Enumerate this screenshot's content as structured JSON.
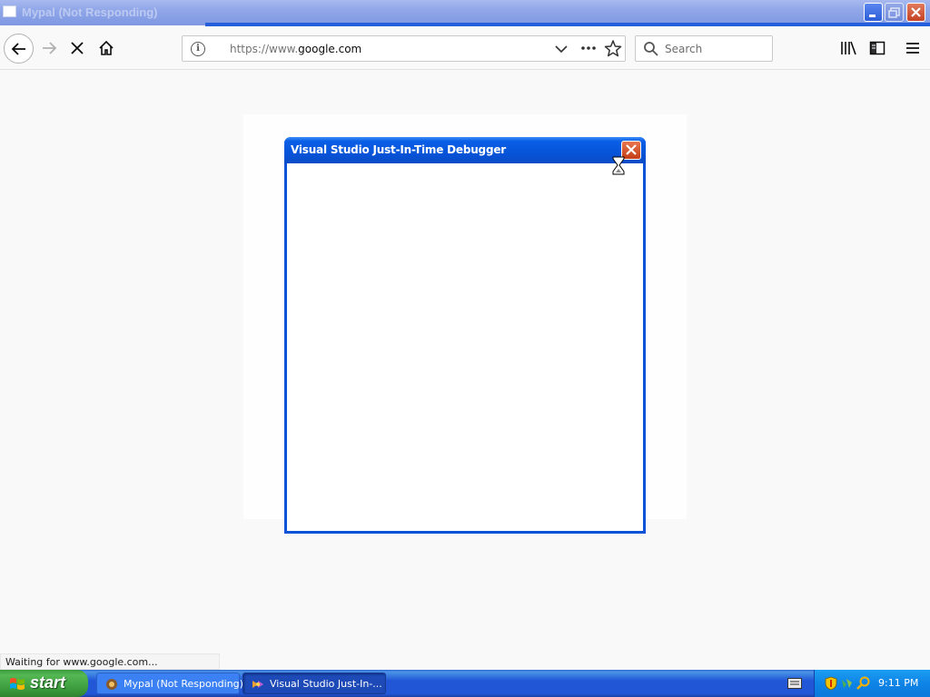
{
  "window": {
    "title": "Mypal (Not Responding)"
  },
  "toolbar": {
    "url_scheme": "https://www.",
    "url_host": "google.com",
    "search_placeholder": "Search"
  },
  "dialog": {
    "title": "Visual Studio Just-In-Time Debugger",
    "close_label": "✕"
  },
  "status": {
    "text": "Waiting for www.google.com..."
  },
  "taskbar": {
    "start_label": "start",
    "tasks": [
      {
        "label": "Mypal (Not Responding)",
        "icon": "mypal-icon"
      },
      {
        "label": "Visual Studio Just-In-...",
        "icon": "visual-studio-icon"
      }
    ],
    "tray_icons": [
      "keyboard-icon",
      "security-shield-icon",
      "network-icon",
      "search-icon"
    ],
    "clock": "9:11 PM"
  },
  "colors": {
    "xp_blue": "#245edb",
    "start_green": "#3c9b3c",
    "close_red": "#c43d18"
  }
}
